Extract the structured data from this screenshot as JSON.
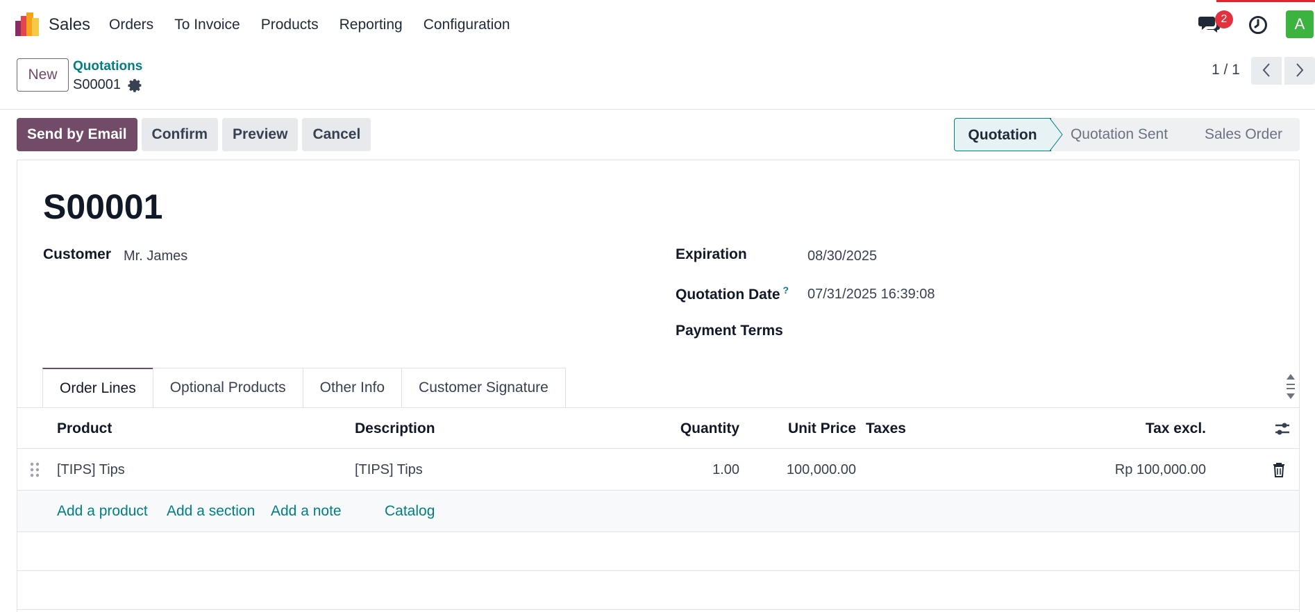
{
  "navbar": {
    "app_name": "Sales",
    "menu": [
      "Orders",
      "To Invoice",
      "Products",
      "Reporting",
      "Configuration"
    ],
    "message_count": "2",
    "avatar_letter": "A"
  },
  "control": {
    "new_label": "New",
    "breadcrumb_parent": "Quotations",
    "breadcrumb_current": "S00001",
    "pager": "1 / 1"
  },
  "actions": {
    "send_email": "Send by Email",
    "confirm": "Confirm",
    "preview": "Preview",
    "cancel": "Cancel"
  },
  "stages": {
    "current": "Quotation",
    "sent": "Quotation Sent",
    "order": "Sales Order"
  },
  "form": {
    "name": "S00001",
    "customer_label": "Customer",
    "customer_value": "Mr. James",
    "expiration_label": "Expiration",
    "expiration_value": "08/30/2025",
    "quotation_date_label": "Quotation Date",
    "quotation_date_help": "?",
    "quotation_date_value": "07/31/2025 16:39:08",
    "payment_terms_label": "Payment Terms"
  },
  "tabs": [
    "Order Lines",
    "Optional Products",
    "Other Info",
    "Customer Signature"
  ],
  "table": {
    "headers": {
      "product": "Product",
      "description": "Description",
      "quantity": "Quantity",
      "unit_price": "Unit Price",
      "taxes": "Taxes",
      "tax_excl": "Tax excl."
    },
    "rows": [
      {
        "product": "[TIPS] Tips",
        "description": "[TIPS] Tips",
        "quantity": "1.00",
        "unit_price": "100,000.00",
        "taxes": "",
        "subtotal": "Rp 100,000.00"
      }
    ],
    "add_links": {
      "product": "Add a product",
      "section": "Add a section",
      "note": "Add a note",
      "catalog": "Catalog"
    }
  },
  "colors": {
    "primary": "#714b67",
    "link": "#017e84",
    "badge": "#e3323f",
    "avatar": "#3bb33e"
  }
}
